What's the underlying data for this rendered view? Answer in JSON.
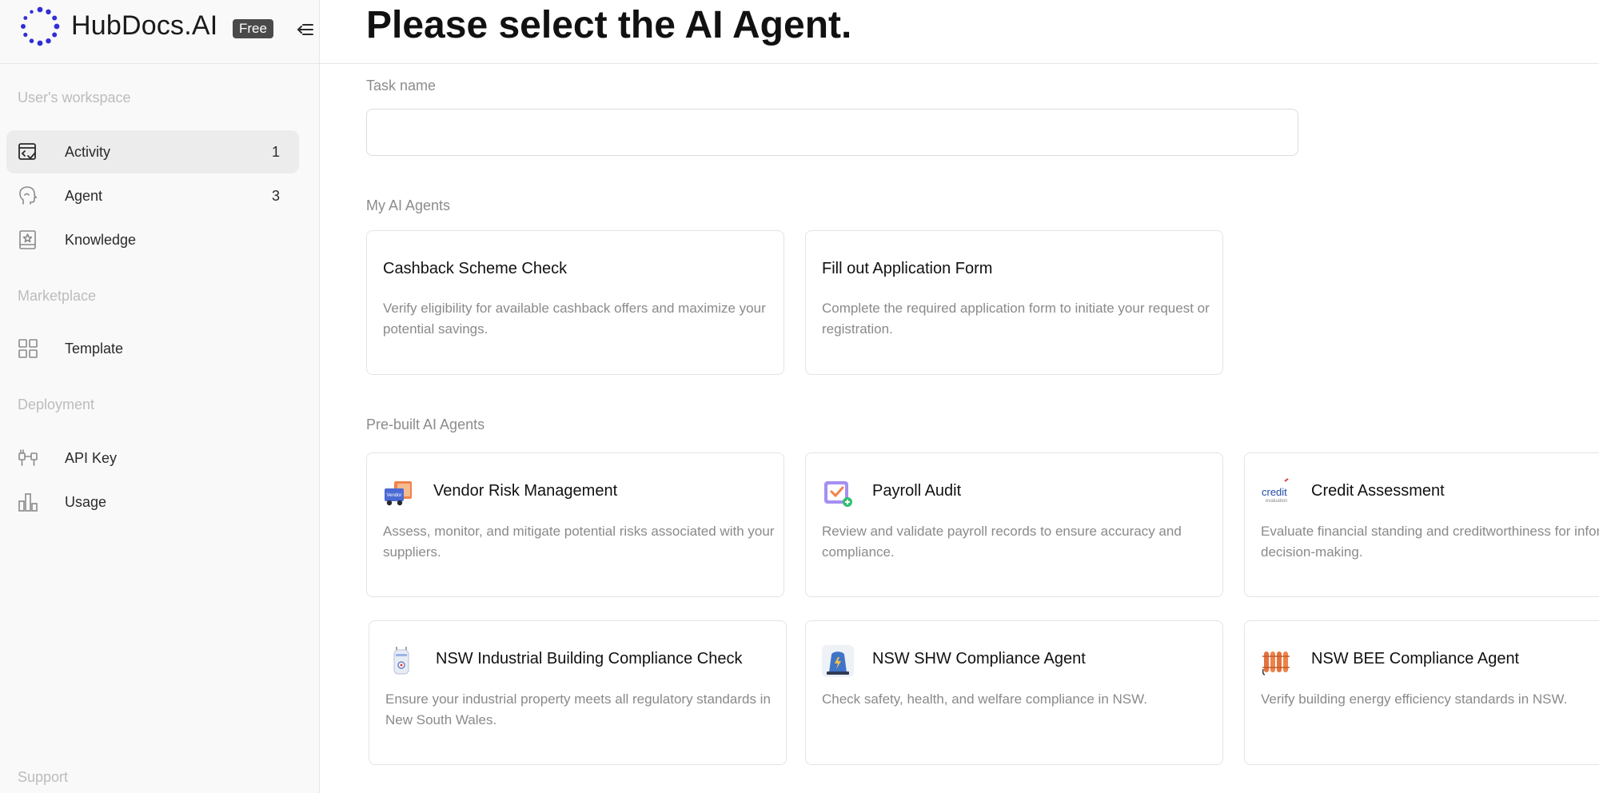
{
  "brand": {
    "name": "HubDocs.AI",
    "badge": "Free"
  },
  "sidebar": {
    "sections": {
      "workspace": "User's workspace",
      "marketplace": "Marketplace",
      "deployment": "Deployment",
      "support": "Support"
    },
    "items": [
      {
        "label": "Activity",
        "count": "1",
        "icon": "activity-icon"
      },
      {
        "label": "Agent",
        "count": "3",
        "icon": "agent-head-icon"
      },
      {
        "label": "Knowledge",
        "icon": "knowledge-book-icon"
      },
      {
        "label": "Template",
        "icon": "template-grid-icon"
      },
      {
        "label": "API Key",
        "icon": "api-key-icon"
      },
      {
        "label": "Usage",
        "icon": "usage-chart-icon"
      }
    ]
  },
  "main": {
    "title": "Please select the AI Agent.",
    "task_name_label": "Task name",
    "task_name_value": "",
    "my_agents_label": "My AI Agents",
    "my_agents": [
      {
        "title": "Cashback Scheme Check",
        "desc": "Verify eligibility for available cashback offers and maximize your potential savings."
      },
      {
        "title": "Fill out Application Form",
        "desc": "Complete the required application form to initiate your request or registration."
      }
    ],
    "prebuilt_label": "Pre-built AI Agents",
    "prebuilt_agents": [
      {
        "title": "Vendor Risk Management",
        "desc": "Assess, monitor, and mitigate potential risks associated with your suppliers.",
        "icon": "vendor-truck-icon",
        "icon_text": "Vendor"
      },
      {
        "title": "Payroll Audit",
        "desc": "Review and validate payroll records to ensure accuracy and compliance.",
        "icon": "payroll-audit-icon"
      },
      {
        "title": "Credit Assessment",
        "desc": "Evaluate financial standing and creditworthiness for informed decision-making.",
        "icon": "credit-logo-icon",
        "icon_text": "credit",
        "icon_subtext": "evaluation"
      },
      {
        "title": "NSW Industrial Building Compliance Check",
        "desc": "Ensure your industrial property meets all regulatory standards in New South Wales.",
        "icon": "industrial-building-icon"
      },
      {
        "title": "NSW SHW Compliance Agent",
        "desc": "Check safety, health, and welfare compliance in NSW.",
        "icon": "water-heater-icon"
      },
      {
        "title": "NSW BEE Compliance Agent",
        "desc": "Verify building energy efficiency standards in NSW.",
        "icon": "radiator-icon"
      }
    ]
  },
  "colors": {
    "brand_blue": "#2f2fd6",
    "accent_orange": "#f0834a",
    "muted_text": "#8a8a8a"
  }
}
